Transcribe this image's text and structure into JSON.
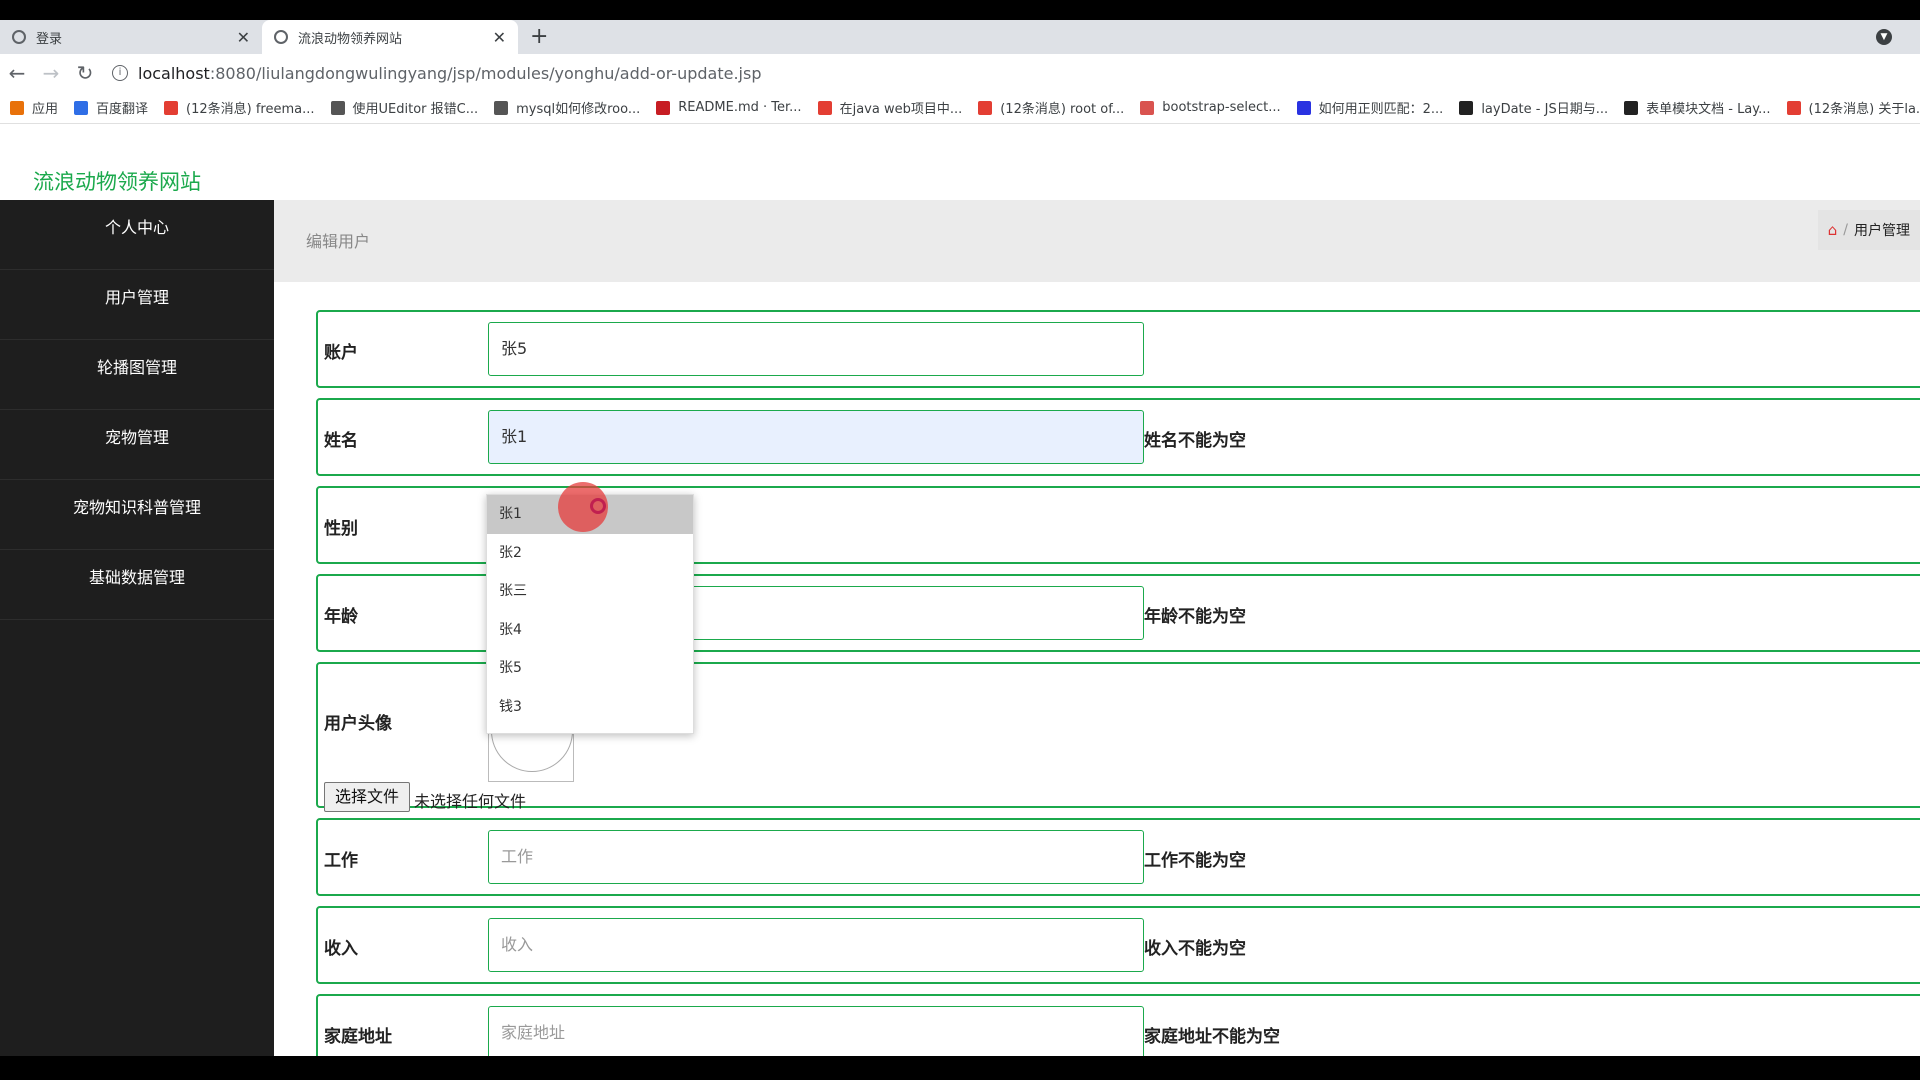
{
  "browser": {
    "tabs": [
      {
        "title": "登录"
      },
      {
        "title": "流浪动物领养网站"
      }
    ],
    "new_tab": "+",
    "url_host": "localhost",
    "url_rest": ":8080/liulangdongwulingyang/jsp/modules/yonghu/add-or-update.jsp",
    "bookmarks": [
      {
        "label": "应用",
        "icon": "apps-icon",
        "color": "#e8710a"
      },
      {
        "label": "百度翻译",
        "icon": "baidu-translate-icon",
        "color": "#2f6ee6"
      },
      {
        "label": "(12条消息) freema...",
        "icon": "csdn-icon",
        "color": "#e33e33"
      },
      {
        "label": "使用UEditor 报错C...",
        "icon": "bird-icon",
        "color": "#555555"
      },
      {
        "label": "mysql如何修改roo...",
        "icon": "bird-icon",
        "color": "#555555"
      },
      {
        "label": "README.md · Ter...",
        "icon": "gitee-icon",
        "color": "#c71d23"
      },
      {
        "label": "在java web项目中...",
        "icon": "csdn-icon",
        "color": "#e33e33"
      },
      {
        "label": "(12条消息) root of...",
        "icon": "csdn-icon",
        "color": "#e33e33"
      },
      {
        "label": "bootstrap-select...",
        "icon": "doc-icon",
        "color": "#d9534f"
      },
      {
        "label": "如何用正则匹配：2...",
        "icon": "baidu-icon",
        "color": "#2932e1"
      },
      {
        "label": "layDate - JS日期与...",
        "icon": "layui-icon",
        "color": "#222222"
      },
      {
        "label": "表单模块文档 - Lay...",
        "icon": "layui-icon",
        "color": "#222222"
      },
      {
        "label": "(12条消息) 关于la...",
        "icon": "csdn-icon",
        "color": "#e33e33"
      }
    ]
  },
  "site": {
    "title": "流浪动物领养网站",
    "accent": "#1ba94c"
  },
  "sidebar": {
    "items": [
      {
        "label": "个人中心"
      },
      {
        "label": "用户管理"
      },
      {
        "label": "轮播图管理"
      },
      {
        "label": "宠物管理"
      },
      {
        "label": "宠物知识科普管理"
      },
      {
        "label": "基础数据管理"
      }
    ]
  },
  "crumb": {
    "title": "编辑用户",
    "right": "用户管理",
    "sep": "/"
  },
  "form": {
    "account": {
      "label": "账户",
      "value": "张5"
    },
    "name": {
      "label": "姓名",
      "value": "张1",
      "error": "姓名不能为空"
    },
    "gender": {
      "label": "性别"
    },
    "age": {
      "label": "年龄",
      "error": "年龄不能为空"
    },
    "avatar": {
      "label": "用户头像",
      "file_button": "选择文件",
      "file_status": "未选择任何文件"
    },
    "job": {
      "label": "工作",
      "placeholder": "工作",
      "error": "工作不能为空"
    },
    "income": {
      "label": "收入",
      "placeholder": "收入",
      "error": "收入不能为空"
    },
    "address": {
      "label": "家庭地址",
      "placeholder": "家庭地址",
      "error": "家庭地址不能为空"
    }
  },
  "dropdown": {
    "options": [
      "张1",
      "张2",
      "张三",
      "张4",
      "张5",
      "钱3"
    ],
    "selected": "张1"
  }
}
